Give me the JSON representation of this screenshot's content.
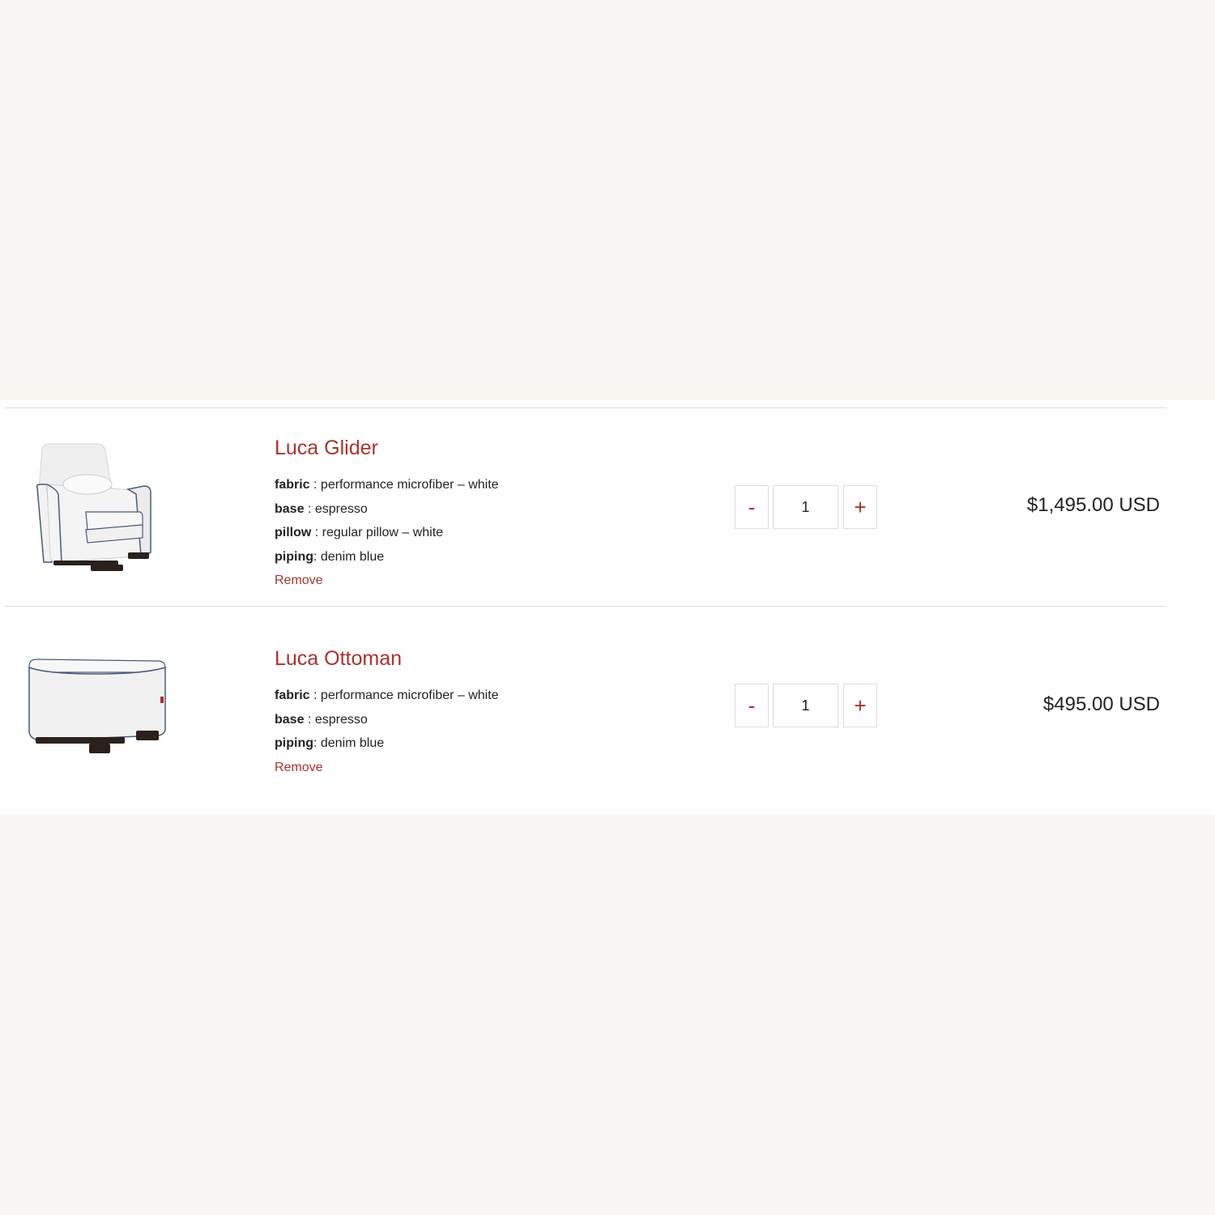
{
  "cart": {
    "items": [
      {
        "title": "Luca Glider",
        "image_icon": "glider-chair-image",
        "options": [
          {
            "key": "fabric",
            "sep": " : ",
            "value": "performance microfiber – white"
          },
          {
            "key": "base",
            "sep": " : ",
            "value": "espresso"
          },
          {
            "key": "pillow",
            "sep": " : ",
            "value": "regular pillow – white"
          },
          {
            "key": "piping",
            "sep": ": ",
            "value": "denim blue"
          }
        ],
        "remove_label": "Remove",
        "minus_label": "-",
        "plus_label": "+",
        "quantity": "1",
        "price": "$1,495.00 USD"
      },
      {
        "title": "Luca Ottoman",
        "image_icon": "ottoman-image",
        "options": [
          {
            "key": "fabric",
            "sep": " : ",
            "value": "performance microfiber – white"
          },
          {
            "key": "base",
            "sep": " : ",
            "value": "espresso"
          },
          {
            "key": "piping",
            "sep": ": ",
            "value": "denim blue"
          }
        ],
        "remove_label": "Remove",
        "minus_label": "-",
        "plus_label": "+",
        "quantity": "1",
        "price": "$495.00 USD"
      }
    ]
  },
  "colors": {
    "page_background": "#f8f5f2",
    "panel_background": "#ffffff",
    "accent": "#a8322c",
    "divider": "#dcdcdc",
    "text": "#222222"
  }
}
